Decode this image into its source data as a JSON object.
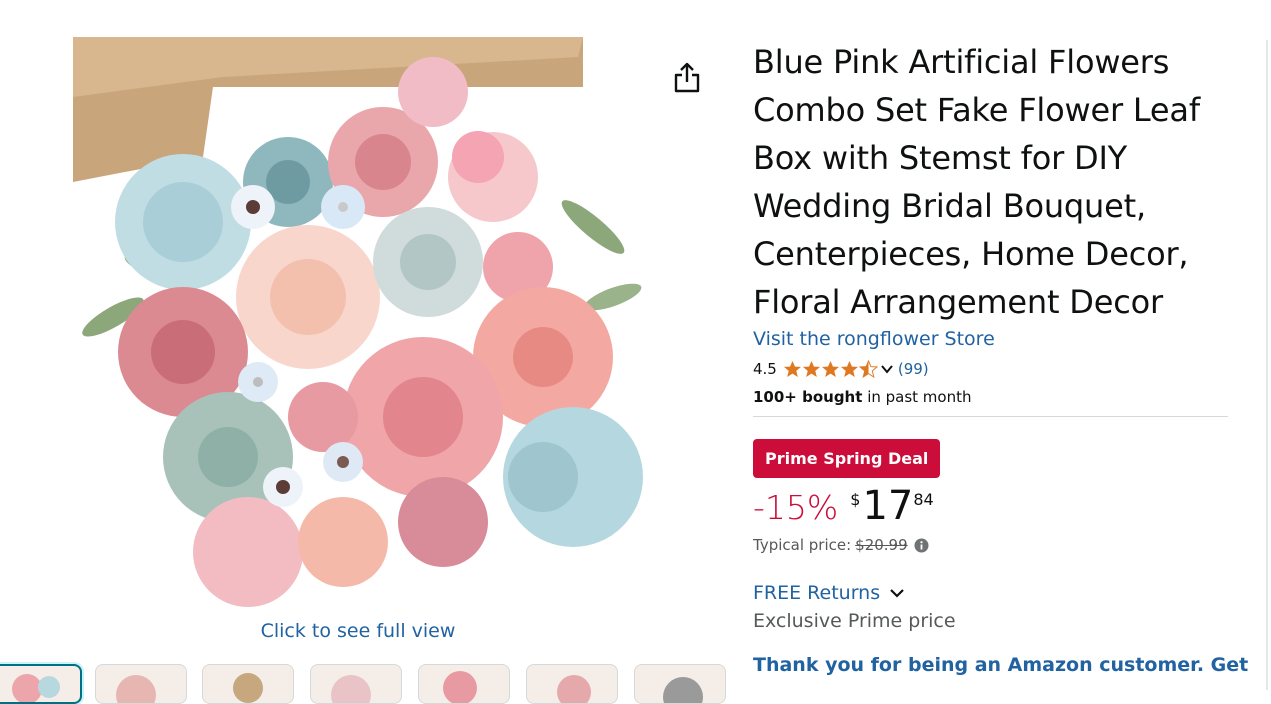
{
  "product": {
    "title": "Blue Pink Artificial Flowers Combo Set Fake Flower Leaf Box with Stemst for DIY Wedding Bridal Bouquet, Centerpieces, Home Decor, Floral Arrangement Decor",
    "store_link": "Visit the rongflower Store",
    "rating": "4.5",
    "rating_value": 4.5,
    "review_count": "(99)",
    "bought_bold": "100+ bought",
    "bought_rest": " in past month"
  },
  "image": {
    "full_view_label": "Click to see full view",
    "share_icon": "share-icon"
  },
  "deal": {
    "badge": "Prime Spring Deal",
    "discount": "-15%",
    "currency": "$",
    "price_whole": "17",
    "price_fraction": "84",
    "typical_label": "Typical price:",
    "typical_price": "$20.99"
  },
  "returns": {
    "label": "FREE Returns",
    "exclusive": "Exclusive Prime price"
  },
  "promo": {
    "text": "Thank you for being an Amazon customer. Get"
  },
  "colors": {
    "link": "#2162a1",
    "deal_red": "#cc0c39",
    "star_orange": "#de7921",
    "text": "#0f1111",
    "muted": "#565959"
  },
  "thumbnails": [
    {
      "name": "thumbnail-1",
      "selected": true
    },
    {
      "name": "thumbnail-2",
      "selected": false
    },
    {
      "name": "thumbnail-3",
      "selected": false
    },
    {
      "name": "thumbnail-4",
      "selected": false
    },
    {
      "name": "thumbnail-5",
      "selected": false
    },
    {
      "name": "thumbnail-6",
      "selected": false
    },
    {
      "name": "thumbnail-7",
      "selected": false
    }
  ]
}
